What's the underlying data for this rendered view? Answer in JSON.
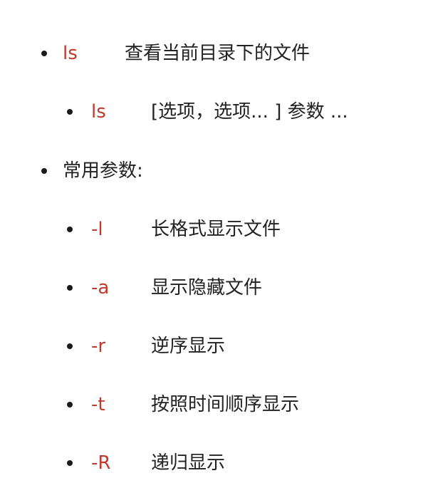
{
  "items": [
    {
      "cmd": "ls",
      "desc": "查看当前目录下的文件"
    },
    {
      "cmd": "ls",
      "desc": "[选项，选项... ]  参数 ..."
    }
  ],
  "params_heading": "常用参数:",
  "params": [
    {
      "flag": "-l",
      "desc": "长格式显示文件"
    },
    {
      "flag": "-a",
      "desc": "显示隐藏文件"
    },
    {
      "flag": "-r",
      "desc": "逆序显示"
    },
    {
      "flag": "-t",
      "desc": "按照时间顺序显示"
    },
    {
      "flag": "-R",
      "desc": "递归显示"
    }
  ],
  "colors": {
    "command": "#c0392b",
    "text": "#222222",
    "bullet": "#1a1a1a",
    "background": "#ffffff"
  }
}
